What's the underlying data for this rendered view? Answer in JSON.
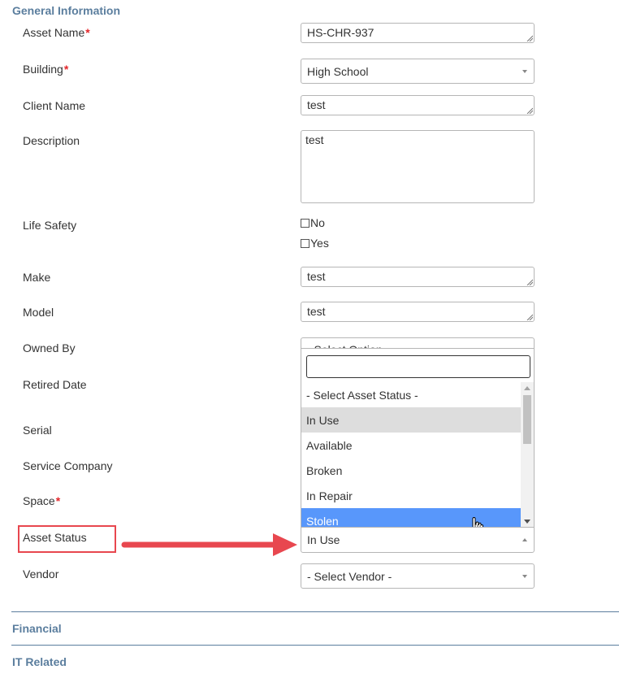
{
  "sections": {
    "general": "General Information",
    "financial": "Financial",
    "it_related": "IT Related"
  },
  "labels": {
    "asset_name": "Asset Name",
    "building": "Building",
    "client_name": "Client Name",
    "description": "Description",
    "life_safety": "Life Safety",
    "make": "Make",
    "model": "Model",
    "owned_by": "Owned By",
    "retired_date": "Retired Date",
    "serial": "Serial",
    "service_company": "Service Company",
    "space": "Space",
    "asset_status": "Asset Status",
    "vendor": "Vendor",
    "required_mark": "*"
  },
  "values": {
    "asset_name": "HS-CHR-937",
    "building": "High School",
    "client_name": "test",
    "description": "test",
    "make": "test",
    "model": "test",
    "owned_by": "- Select Option -",
    "asset_status": "In Use",
    "vendor": "- Select Vendor -"
  },
  "life_safety_options": [
    "No",
    "Yes"
  ],
  "asset_status_dropdown": {
    "search_value": "",
    "options": [
      "- Select Asset Status -",
      "In Use",
      "Available",
      "Broken",
      "In Repair",
      "Stolen"
    ],
    "hovered": "In Use",
    "selected": "Stolen"
  },
  "colors": {
    "section": "#5b7e9e",
    "required": "#e3262a",
    "annotation": "#e8474f",
    "selected_option": "#5897fb"
  }
}
